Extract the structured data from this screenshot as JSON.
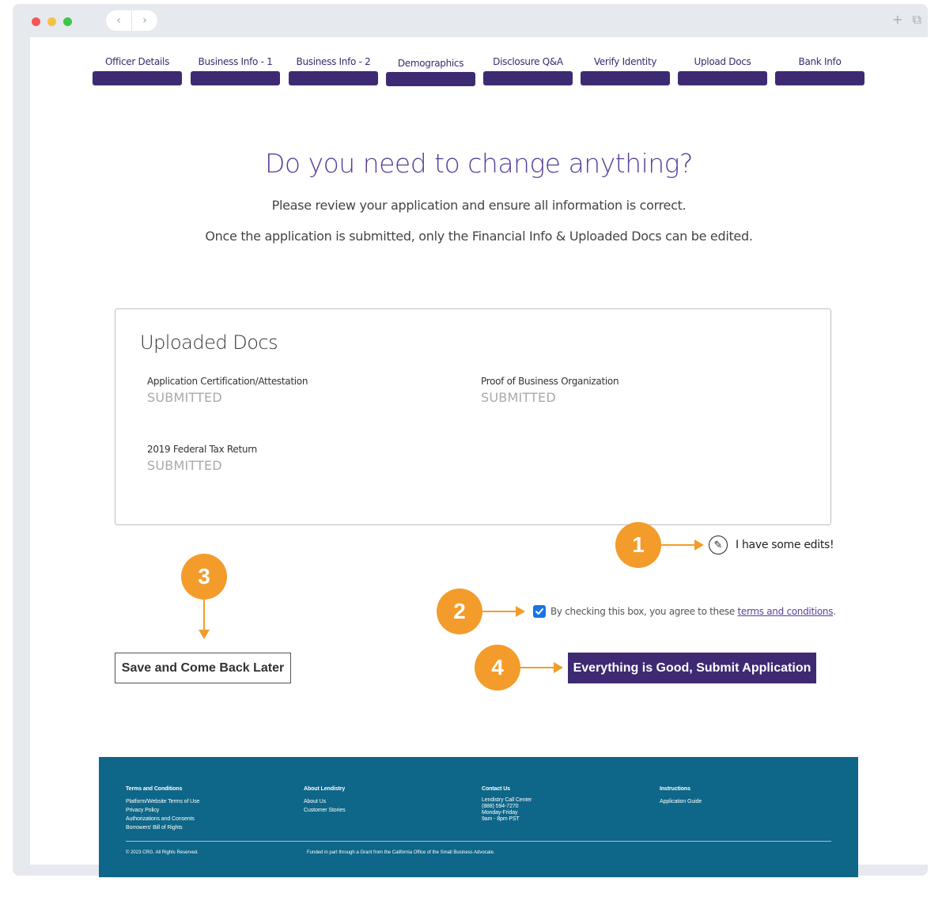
{
  "browser": {
    "back_glyph": "‹",
    "forward_glyph": "›",
    "new_tab_glyph": "+",
    "window_glyph": "⧉"
  },
  "steps": [
    {
      "label": "Officer Details"
    },
    {
      "label": "Business Info - 1"
    },
    {
      "label": "Business Info - 2"
    },
    {
      "label": "Demographics"
    },
    {
      "label": "Disclosure Q&A"
    },
    {
      "label": "Verify Identity"
    },
    {
      "label": "Upload Docs"
    },
    {
      "label": "Bank Info"
    }
  ],
  "header": {
    "title": "Do you need to change anything?",
    "subtitle1": "Please review your application and ensure all information is correct.",
    "subtitle2": "Once the application is submitted, only the Financial Info & Uploaded Docs can be edited."
  },
  "uploaded_docs": {
    "title": "Uploaded Docs",
    "items": [
      {
        "name": "Application Certification/Attestation",
        "status": "SUBMITTED"
      },
      {
        "name": "Proof of Business Organization",
        "status": "SUBMITTED"
      },
      {
        "name": "2019 Federal Tax Return",
        "status": "SUBMITTED"
      }
    ]
  },
  "callouts": [
    "1",
    "2",
    "3",
    "4"
  ],
  "edits": {
    "label": "I have some edits!",
    "icon": "pencil-icon"
  },
  "terms": {
    "checked": true,
    "text": "By checking this box, you agree to these ",
    "link": "terms and conditions",
    "suffix": "."
  },
  "actions": {
    "save_label": "Save and Come Back Later",
    "submit_label": "Everything is Good, Submit Application"
  },
  "footer": {
    "columns": [
      {
        "heading": "Terms and Conditions",
        "links": [
          "Platform/Website Terms of Use",
          "Privacy Policy",
          "Authorizations and Consents",
          "Borrowers' Bill of Rights"
        ]
      },
      {
        "heading": "About Lendistry",
        "links": [
          "About Us",
          "Customer Stories"
        ]
      },
      {
        "heading": "Contact Us",
        "links": [
          "Lendistry Call Center",
          "(888) 594-7270",
          "Monday-Friday",
          "9am - 8pm PST"
        ]
      },
      {
        "heading": "Instructions",
        "links": [
          "Application Guide"
        ]
      }
    ],
    "copyright": "© 2023 CRG. All Rights Reserved.",
    "funding_note": "Funded in part through a Grant from the California Office of the Small Business Advocate."
  },
  "colors": {
    "primary": "#3d2a72",
    "callout": "#f39c2c",
    "footer": "#0e6688",
    "checkbox": "#1a73e8"
  }
}
